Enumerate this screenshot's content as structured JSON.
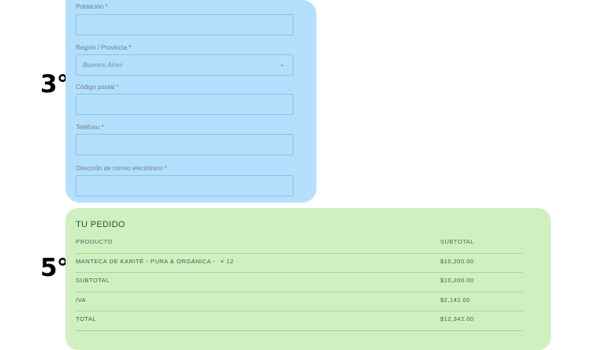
{
  "steps": {
    "billing": "3°",
    "order": "5°"
  },
  "billing": {
    "fields": [
      {
        "label": "Población",
        "required": "*",
        "value": ""
      },
      {
        "label": "Región / Provincia",
        "required": "*",
        "value": "Buenos Aires"
      },
      {
        "label": "Código postal",
        "required": "*",
        "value": ""
      },
      {
        "label": "Teléfono",
        "required": "*",
        "value": ""
      },
      {
        "label": "Dirección de correo electrónico",
        "required": "*",
        "value": ""
      }
    ],
    "select_chevron": "⌄"
  },
  "order": {
    "title": "TU PEDIDO",
    "headers": {
      "product": "PRODUCTO",
      "subtotal": "SUBTOTAL"
    },
    "items": [
      {
        "name": "MANTECA DE KARITÉ - PURA & ORGÁNICA -",
        "qty": "× 12",
        "total": "$10,200.00"
      }
    ],
    "subtotal": {
      "label": "SUBTOTAL",
      "value": "$10,200.00"
    },
    "tax": {
      "label": "IVA",
      "value": "$2,142.00"
    },
    "total": {
      "label": "TOTAL",
      "value": "$12,342.00"
    }
  },
  "colors": {
    "billing_bg": "#b4e0fd",
    "order_bg": "#cff0c0"
  }
}
